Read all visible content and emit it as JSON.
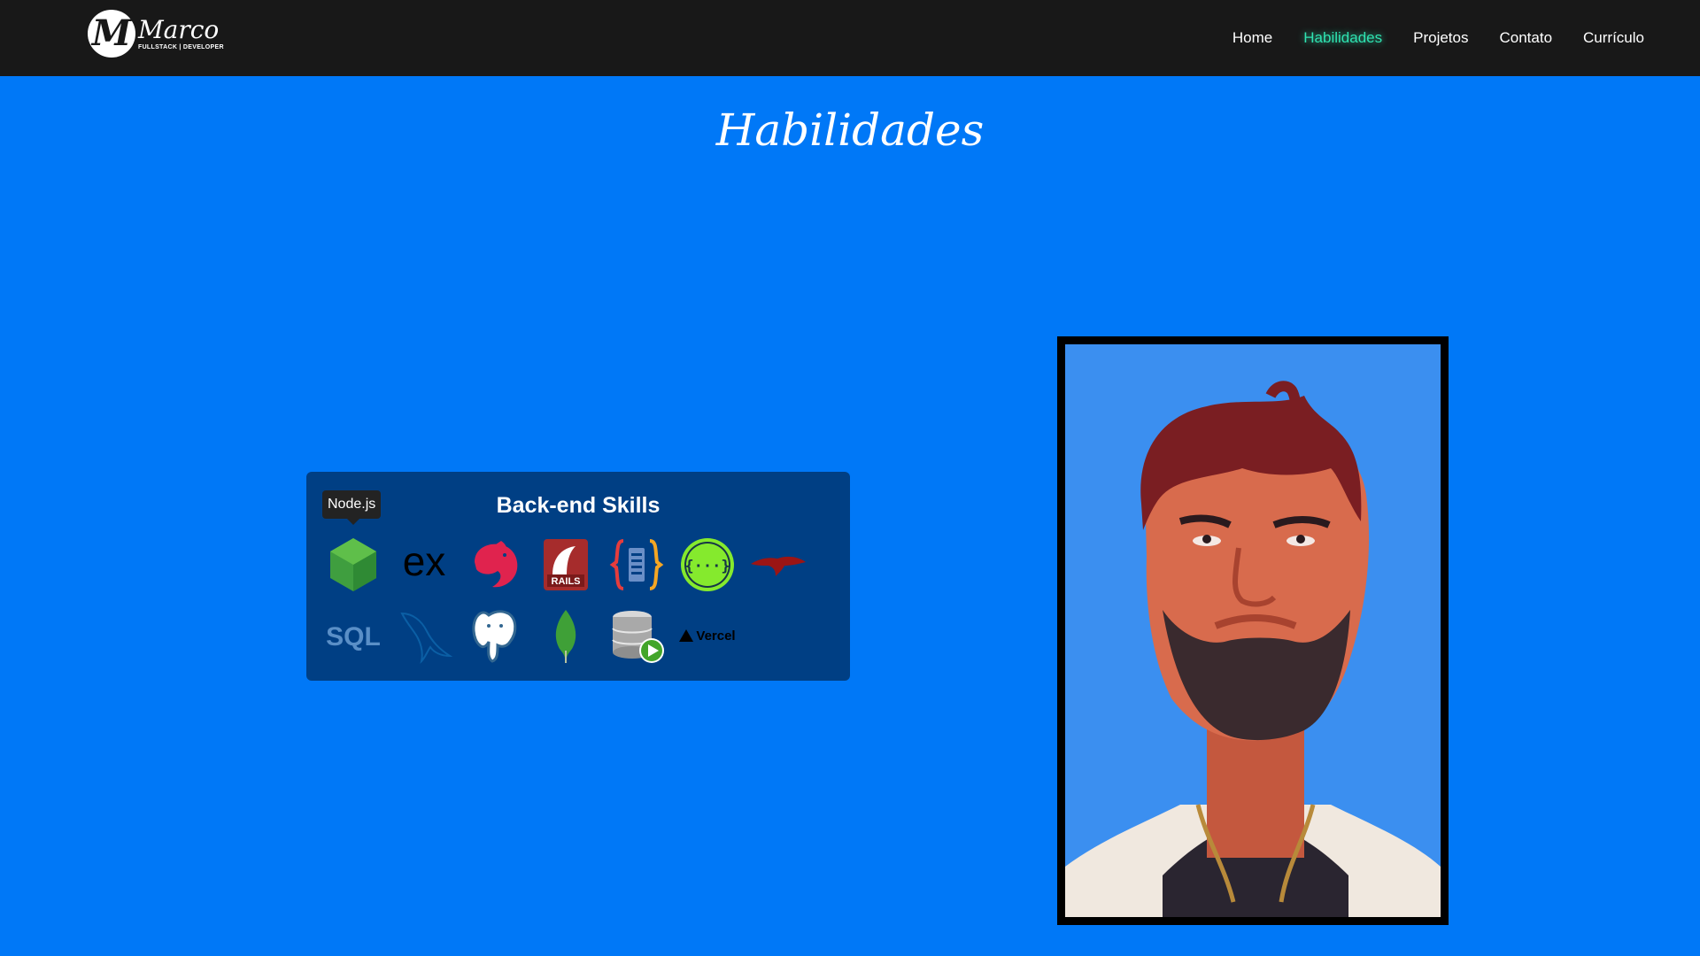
{
  "header": {
    "logo": {
      "name": "Marco",
      "tagline": "FULLSTACK | DEVELOPER",
      "monogram": "M",
      "icon": "logo-monogram-icon"
    },
    "nav": [
      {
        "label": "Home",
        "active": false
      },
      {
        "label": "Habilidades",
        "active": true
      },
      {
        "label": "Projetos",
        "active": false
      },
      {
        "label": "Contato",
        "active": false
      },
      {
        "label": "Currículo",
        "active": false
      }
    ]
  },
  "main": {
    "title": "Habilidades",
    "skills_card": {
      "title": "Back-end Skills",
      "tooltip": "Node.js",
      "rows": [
        [
          {
            "icon": "nodejs-icon"
          },
          {
            "icon": "express-icon",
            "text": "ex"
          },
          {
            "icon": "nestjs-icon"
          },
          {
            "icon": "rails-icon",
            "text": "RAILS"
          },
          {
            "icon": "json-server-icon"
          },
          {
            "icon": "swagger-icon",
            "text": "{···}"
          },
          {
            "icon": "ruby-gem-icon"
          }
        ],
        [
          {
            "icon": "sql-icon",
            "text": "SQL"
          },
          {
            "icon": "mysql-dolphin-icon"
          },
          {
            "icon": "postgresql-icon"
          },
          {
            "icon": "mongodb-leaf-icon"
          },
          {
            "icon": "database-run-icon"
          },
          {
            "icon": "vercel-icon",
            "text": "Vercel"
          }
        ]
      ]
    },
    "portrait": {
      "icon": "pixel-art-portrait"
    }
  },
  "colors": {
    "background": "#0078f7",
    "topbar": "#181818",
    "nav_active": "#2fe3b1",
    "card": "#003f84",
    "portrait_bg": "#3b8ff0"
  }
}
